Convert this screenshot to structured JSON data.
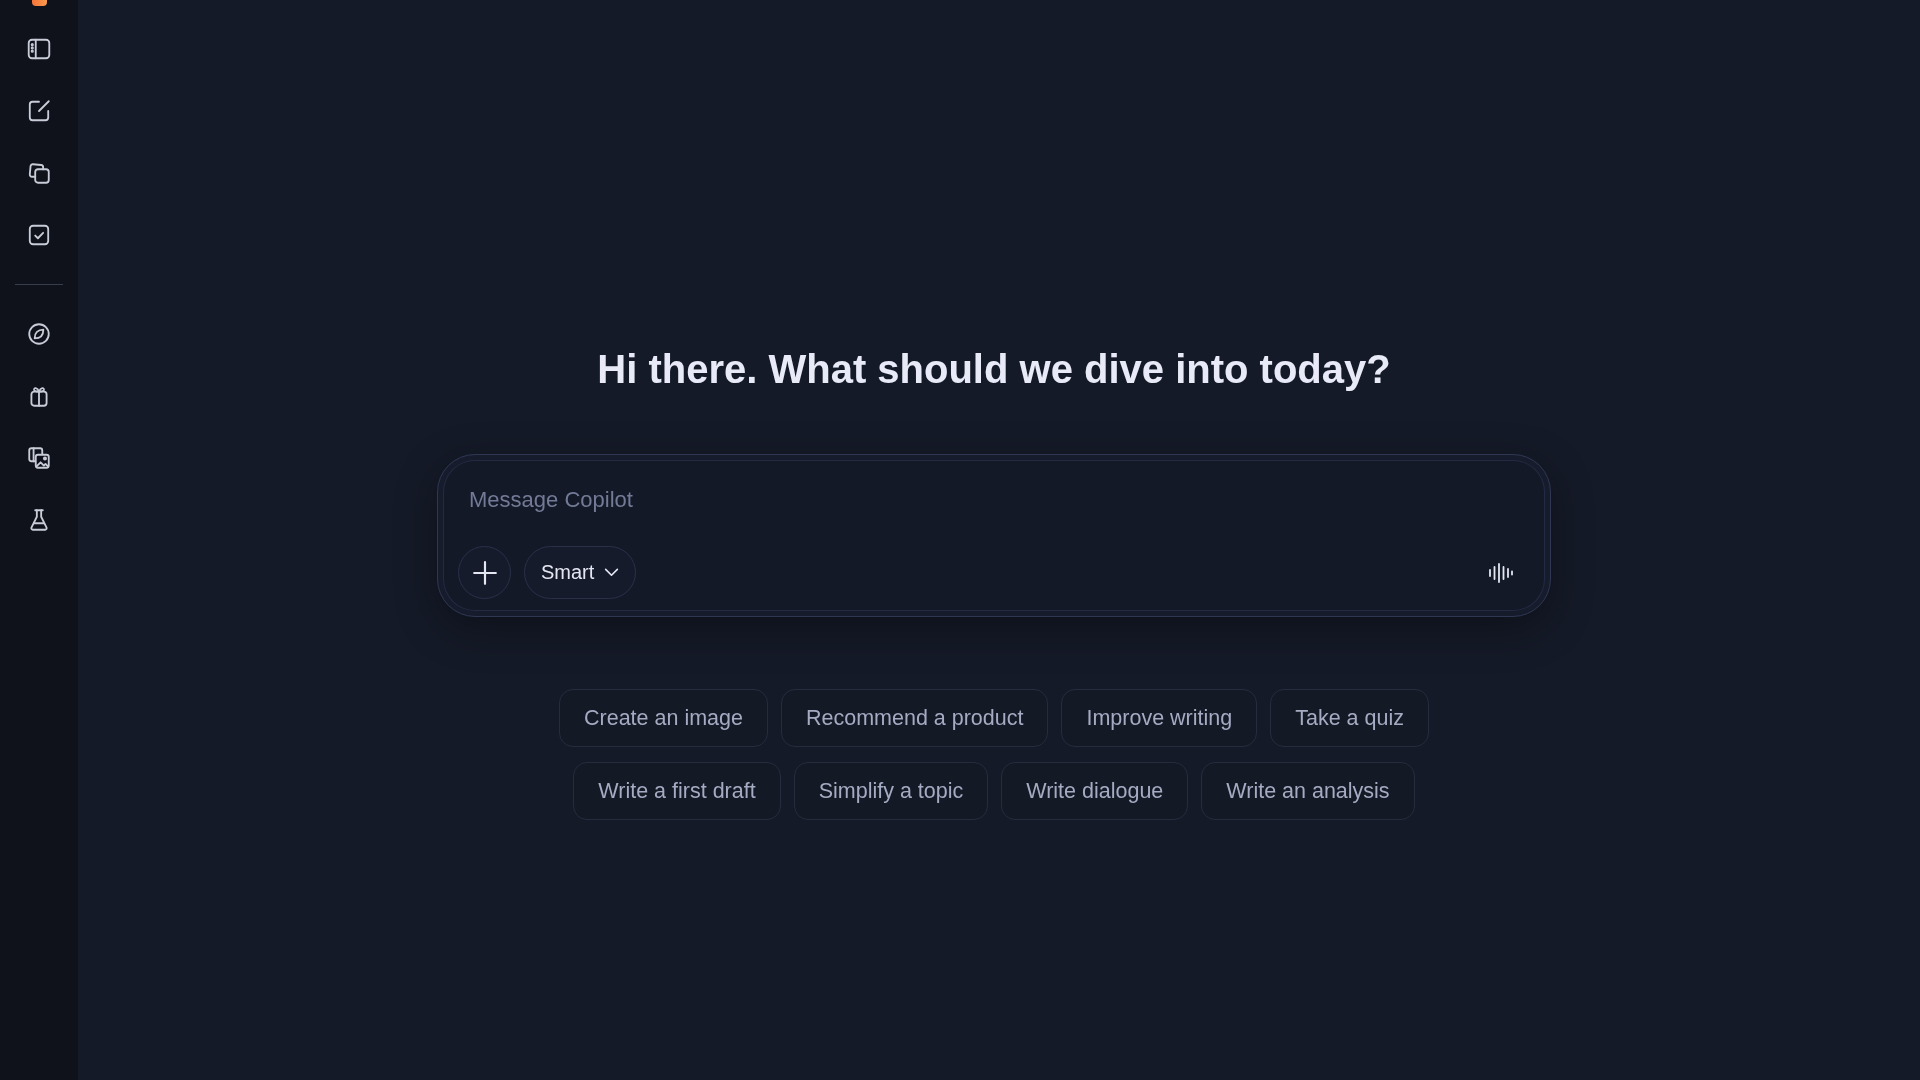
{
  "heading": "Hi there. What should we dive into today?",
  "composer": {
    "placeholder": "Message Copilot",
    "mode": "Smart"
  },
  "suggestions": [
    [
      "Create an image",
      "Recommend a product",
      "Improve writing",
      "Take a quiz"
    ],
    [
      "Write a first draft",
      "Simplify a topic",
      "Write dialogue",
      "Write an analysis"
    ]
  ]
}
